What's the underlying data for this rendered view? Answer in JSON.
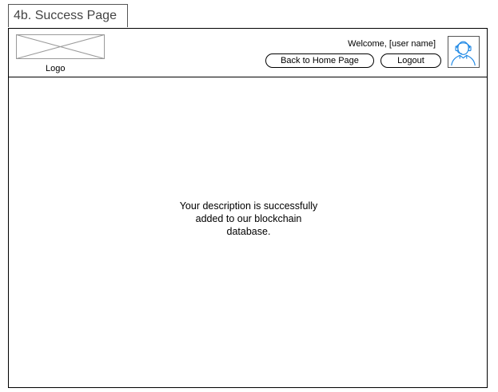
{
  "page_tab": {
    "title": "4b. Success Page"
  },
  "header": {
    "logo_label": "Logo",
    "welcome_text": "Welcome, [user name]",
    "home_button_label": "Back to Home Page",
    "logout_button_label": "Logout",
    "avatar_icon": "user-avatar-icon"
  },
  "main": {
    "message_lines": [
      "Your description is successfully",
      "added to our blockchain",
      "database."
    ]
  },
  "colors": {
    "avatar_accent": "#1e88e5",
    "placeholder_stroke": "#9a9a9a"
  }
}
